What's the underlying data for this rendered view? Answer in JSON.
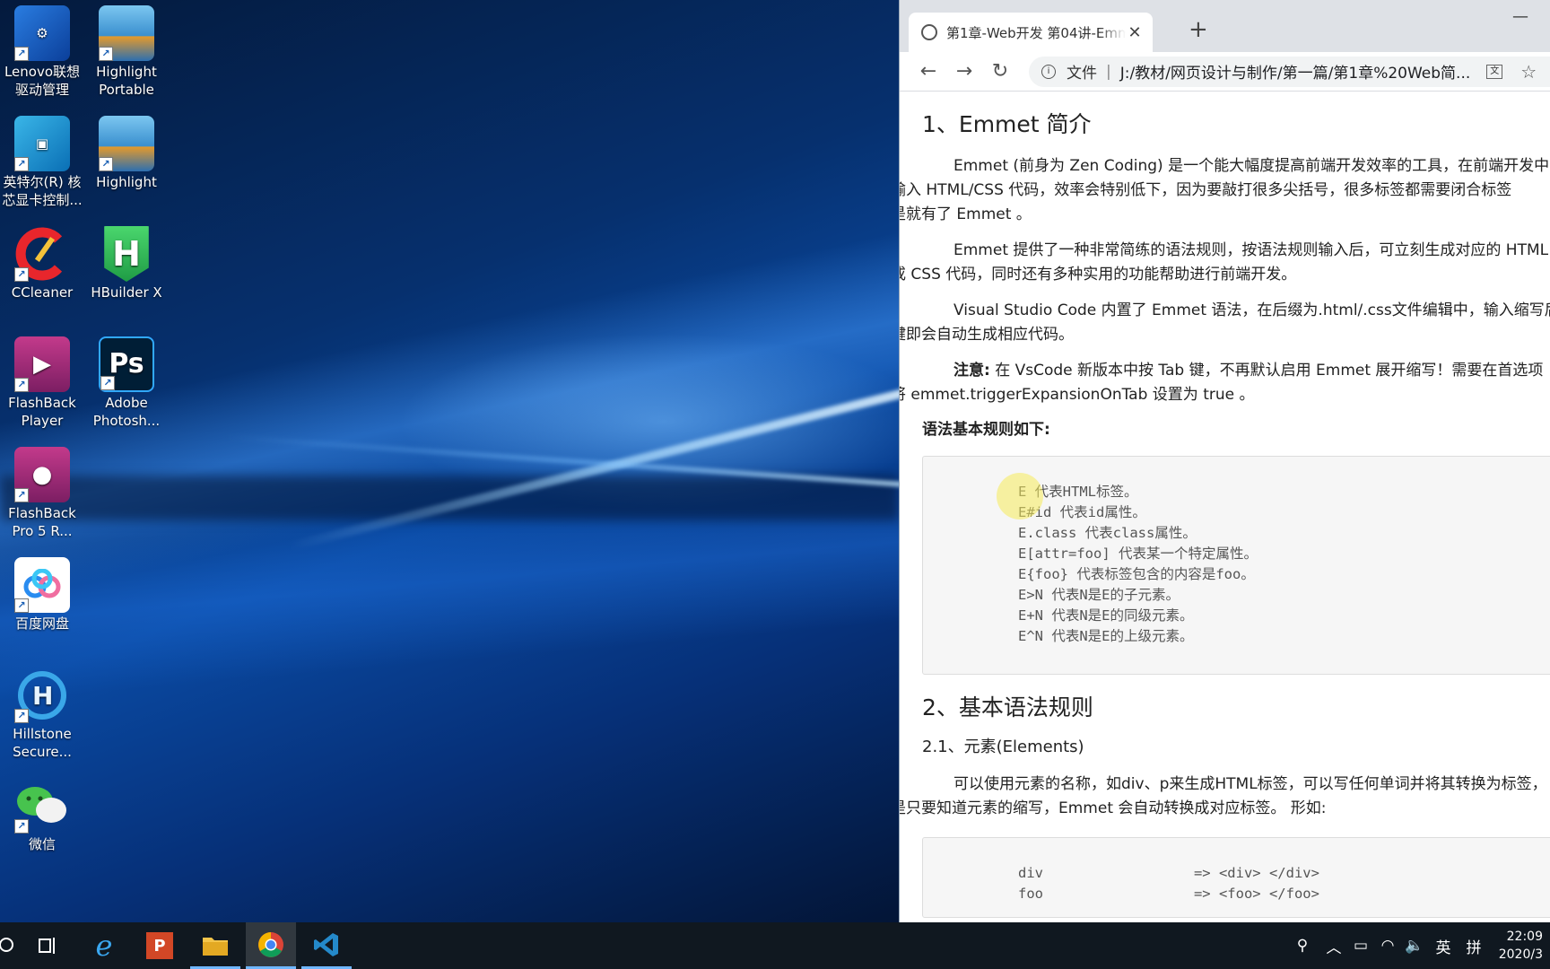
{
  "desktop": {
    "icons": [
      {
        "label_1": "Lenovo联想",
        "label_2": "驱动管理"
      },
      {
        "label_1": "Highlight",
        "label_2": "Portable"
      },
      {
        "label_1": "英特尔(R) 核",
        "label_2": "芯显卡控制..."
      },
      {
        "label_1": "Highlight",
        "label_2": ""
      },
      {
        "label_1": "CCleaner",
        "label_2": ""
      },
      {
        "label_1": "HBuilder X",
        "label_2": ""
      },
      {
        "label_1": "FlashBack",
        "label_2": "Player"
      },
      {
        "label_1": "Adobe",
        "label_2": "Photosh..."
      },
      {
        "label_1": "FlashBack",
        "label_2": "Pro 5 R..."
      },
      {
        "label_1": "百度网盘",
        "label_2": ""
      },
      {
        "label_1": "Hillstone",
        "label_2": "Secure..."
      },
      {
        "label_1": "微信",
        "label_2": ""
      }
    ]
  },
  "browser": {
    "tab_title": "第1章-Web开发 第04讲-Emmet",
    "url_prefix": "文件",
    "url": "J:/教材/网页设计与制作/第一篇/第1章%20Web简..."
  },
  "article": {
    "h1": "1、Emmet 简介",
    "p1_line1": "Emmet (前身为 Zen Coding) 是一个能大幅度提高前端开发效率的工具，在前端开发中，",
    "p1_line2": "输入 HTML/CSS 代码，效率会特别低下，因为要敲打很多尖括号，很多标签都需要闭合标签",
    "p1_line3": "是就有了 Emmet 。",
    "p2_line1": "Emmet 提供了一种非常简练的语法规则，按语法规则输入后，可立刻生成对应的 HTML",
    "p2_line2": "或 CSS 代码，同时还有多种实用的功能帮助进行前端开发。",
    "p3_line1": " Visual Studio Code 内置了 Emmet 语法，在后缀为.html/.css文件编辑中，输入缩写后",
    "p3_line2": "键即会自动生成相应代码。",
    "p4_bold": "注意:",
    "p4_line1": " 在 VsCode 新版本中按 Tab 键，不再默认启用 Emmet 展开缩写！需要在首选项",
    "p4_line2": "将 emmet.triggerExpansionOnTab 设置为 true 。",
    "rules_heading": "语法基本规则如下:",
    "rules": [
      "E 代表HTML标签。",
      "E#id 代表id属性。",
      "E.class 代表class属性。",
      "E[attr=foo] 代表某一个特定属性。",
      "E{foo} 代表标签包含的内容是foo。",
      "E>N 代表N是E的子元素。",
      "E+N 代表N是E的同级元素。",
      "E^N 代表N是E的上级元素。"
    ],
    "h2": "2、基本语法规则",
    "h3": "2.1、元素(Elements)",
    "p5_line1": "可以使用元素的名称，如div、p来生成HTML标签，可以写任何单词并将其转换为标签，",
    "p5_line2": "是只要知道元素的缩写，Emmet 会自动转换成对应标签。 形如:",
    "code2": [
      "div                  => <div> </div>",
      "foo                  => <foo> </foo>"
    ]
  },
  "taskbar": {
    "ime": "英",
    "layout": "拼",
    "time": "22:09",
    "date": "2020/3"
  }
}
